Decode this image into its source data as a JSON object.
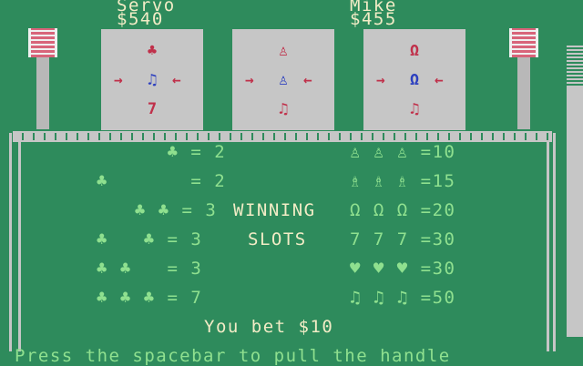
{
  "players": [
    {
      "name": "Servo",
      "money": "$540"
    },
    {
      "name": "Mike",
      "money": "$455"
    }
  ],
  "reels": [
    {
      "top": "♣",
      "mid": "♫",
      "bot": "7"
    },
    {
      "top": "♙",
      "mid": "♙",
      "bot": "♫"
    },
    {
      "top": "Ω",
      "mid": "Ω",
      "bot": "♫"
    }
  ],
  "arrows": {
    "left": "→",
    "right": "←"
  },
  "payouts_left": [
    "        ♣ = 2",
    "  ♣       = 2",
    "    ♣ ♣ = 3",
    "  ♣   ♣ = 3",
    "  ♣ ♣   = 3",
    "  ♣ ♣ ♣ = 7"
  ],
  "payouts_right": [
    "♙ ♙ ♙ =10",
    "♗ ♗ ♗ =15",
    "Ω Ω Ω =20",
    "7 7 7 =30",
    "♥ ♥ ♥ =30",
    "♫ ♫ ♫ =50"
  ],
  "title": [
    "WINNING",
    "SLOTS"
  ],
  "bet": "You bet $10",
  "prompt": "Press the spacebar to pull the handle",
  "colors": {
    "background": "#2e8b5c",
    "text": "#f2ecc6",
    "payout_text": "#8fe08f",
    "reel": "#c6c6c6",
    "symbol_red": "#c0304a",
    "symbol_blue": "#2c3fbf"
  }
}
